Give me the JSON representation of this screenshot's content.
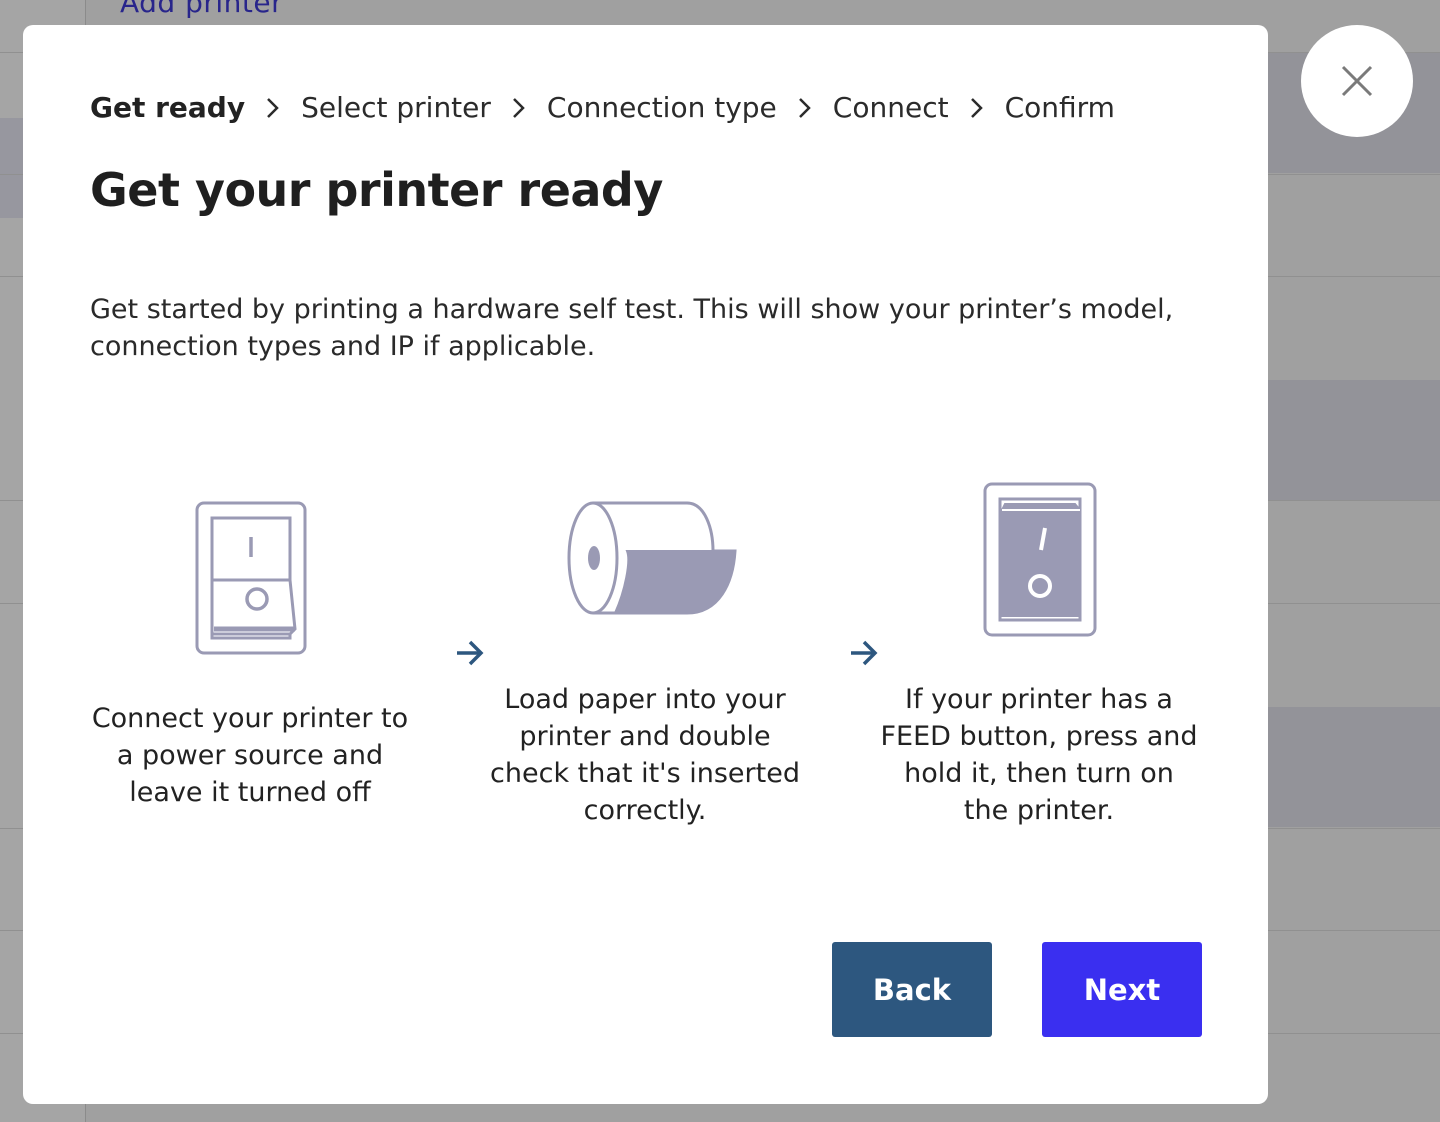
{
  "background": {
    "link_text": "Add printer"
  },
  "modal": {
    "close_icon": "close-icon",
    "breadcrumb": [
      {
        "label": "Get ready",
        "current": true
      },
      {
        "label": "Select printer",
        "current": false
      },
      {
        "label": "Connection type",
        "current": false
      },
      {
        "label": "Connect",
        "current": false
      },
      {
        "label": "Confirm",
        "current": false
      }
    ],
    "title": "Get your printer ready",
    "intro_line1": "Get started by printing a hardware self test. This will show your printer’s model,",
    "intro_line2": "connection types and IP if applicable.",
    "steps": [
      {
        "icon": "power-switch-off-icon",
        "lines": [
          "Connect your printer to",
          "a power source and",
          "leave it turned off"
        ]
      },
      {
        "icon": "paper-roll-icon",
        "lines": [
          "Load paper into your",
          "printer and double",
          "check that it's inserted",
          "correctly."
        ]
      },
      {
        "icon": "power-switch-on-icon",
        "lines": [
          "If your printer has a",
          "FEED button, press and",
          "hold it, then turn on",
          "the printer."
        ]
      }
    ],
    "back_label": "Back",
    "next_label": "Next"
  },
  "colors": {
    "icon_stroke": "#9a9ab4",
    "icon_fill": "#9a9ab4",
    "arrow": "#2d577f",
    "back_button": "#2d577f",
    "next_button": "#3a2ff0"
  }
}
